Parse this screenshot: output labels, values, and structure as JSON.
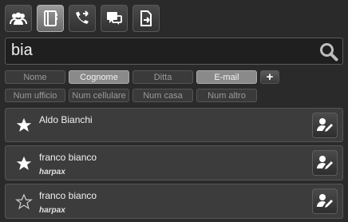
{
  "toolbar": {
    "buttons": [
      {
        "icon": "contacts-group-icon",
        "active": false
      },
      {
        "icon": "address-book-icon",
        "active": true
      },
      {
        "icon": "call-forward-icon",
        "active": false
      },
      {
        "icon": "chat-icon",
        "active": false
      },
      {
        "icon": "export-icon",
        "active": false
      }
    ]
  },
  "search": {
    "value": "bia",
    "icon": "search-icon"
  },
  "filters": {
    "row1": [
      {
        "label": "Nome",
        "on": false
      },
      {
        "label": "Cognome",
        "on": true
      },
      {
        "label": "Ditta",
        "on": false
      },
      {
        "label": "E-mail",
        "on": true
      }
    ],
    "add_label": "+",
    "row2": [
      {
        "label": "Num ufficio"
      },
      {
        "label": "Num cellulare"
      },
      {
        "label": "Num casa"
      },
      {
        "label": "Num altro"
      }
    ]
  },
  "contacts": [
    {
      "name": "Aldo Bianchi",
      "company": "",
      "favorite": true
    },
    {
      "name": "franco bianco",
      "company": "harpax",
      "favorite": true
    },
    {
      "name": "franco bianco",
      "company": "harpax",
      "favorite": false
    }
  ],
  "colors": {
    "background": "#2a2a2a",
    "active_chip": "#8a8a8a"
  }
}
